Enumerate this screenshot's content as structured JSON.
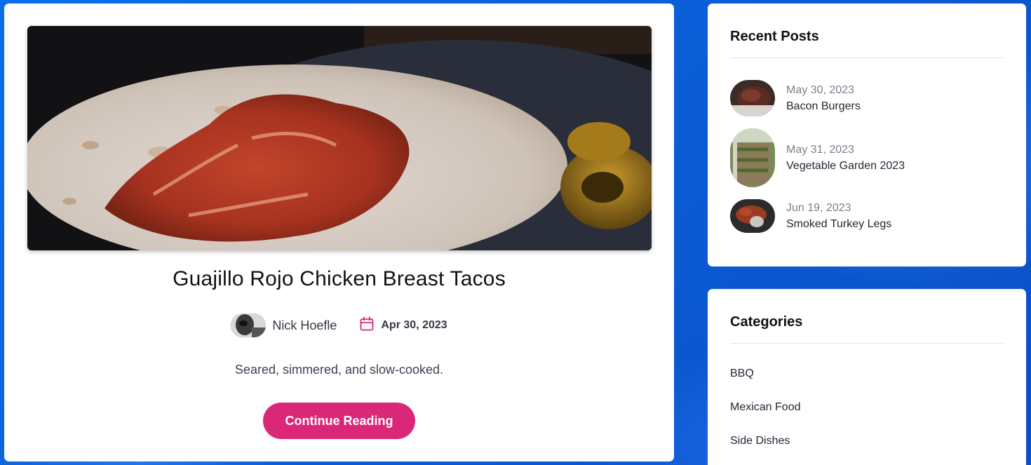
{
  "post": {
    "title": "Guajillo Rojo Chicken Breast Tacos",
    "author": "Nick Hoefle",
    "date": "Apr 30, 2023",
    "excerpt": "Seared, simmered, and slow-cooked.",
    "continue_label": "Continue Reading",
    "accent_color": "#db2777"
  },
  "sidebar": {
    "recent_posts": {
      "title": "Recent Posts",
      "items": [
        {
          "date": "May 30, 2023",
          "title": "Bacon Burgers"
        },
        {
          "date": "May 31, 2023",
          "title": "Vegetable Garden 2023"
        },
        {
          "date": "Jun 19, 2023",
          "title": "Smoked Turkey Legs"
        }
      ]
    },
    "categories": {
      "title": "Categories",
      "items": [
        "BBQ",
        "Mexican Food",
        "Side Dishes"
      ]
    }
  },
  "icons": {
    "date": "calendar-icon"
  }
}
